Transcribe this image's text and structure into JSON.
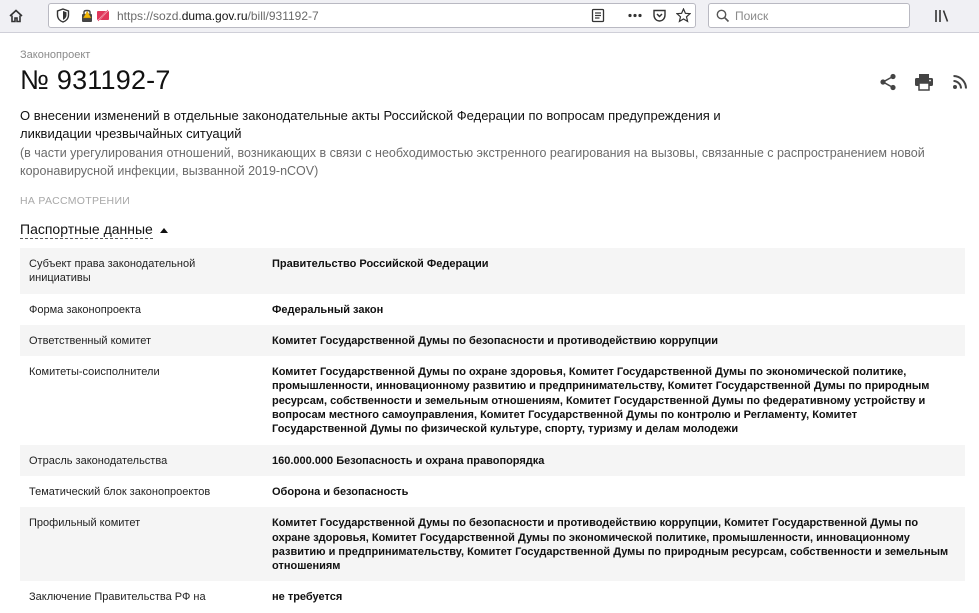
{
  "browser": {
    "url_prefix": "https://sozd.",
    "url_domain": "duma.gov.ru",
    "url_path": "/bill/931192-7",
    "search_placeholder": "Поиск"
  },
  "bill": {
    "kicker": "Законопроект",
    "number": "№ 931192-7",
    "title": "О внесении изменений в отдельные законодательные акты Российской Федерации по вопросам предупреждения и ликвидации чрезвычайных ситуаций",
    "subtitle": "(в части урегулирования отношений, возникающих в связи с необходимостью экстренного реагирования на вызовы, связанные с распространением новой коронавирусной инфекции, вызванной 2019-nCOV)",
    "status": "НА РАССМОТРЕНИИ"
  },
  "passport": {
    "label": "Паспортные данные",
    "rows": [
      {
        "label": "Субъект права законодательной инициативы",
        "value": "Правительство Российской Федерации"
      },
      {
        "label": "Форма законопроекта",
        "value": "Федеральный закон"
      },
      {
        "label": "Ответственный комитет",
        "value": "Комитет Государственной Думы по безопасности и противодействию коррупции"
      },
      {
        "label": "Комитеты-соисполнители",
        "value": "Комитет Государственной Думы по охране здоровья, Комитет Государственной Думы по экономической политике, промышленности, инновационному развитию и предпринимательству, Комитет Государственной Думы по природным ресурсам, собственности и земельным отношениям, Комитет Государственной Думы по федеративному устройству и вопросам местного самоуправления, Комитет Государственной Думы по контролю и Регламенту, Комитет Государственной Думы по физической культуре, спорту, туризму и делам молодежи"
      },
      {
        "label": "Отрасль законодательства",
        "value": "160.000.000 Безопасность и охрана правопорядка"
      },
      {
        "label": "Тематический блок законопроектов",
        "value": "Оборона и безопасность"
      },
      {
        "label": "Профильный комитет",
        "value": "Комитет Государственной Думы по безопасности и противодействию коррупции, Комитет Государственной Думы по охране здоровья, Комитет Государственной Думы по экономической политике, промышленности, инновационному развитию и предпринимательству, Комитет Государственной Думы по природным ресурсам, собственности и земельным отношениям"
      },
      {
        "label": "Заключение Правительства РФ на",
        "value": "не требуется"
      }
    ]
  },
  "icons": {
    "share": "share-icon",
    "print": "print-icon",
    "rss": "rss-icon"
  },
  "colors": {
    "toolbar_bg": "#f0f0f4",
    "row_stripe": "#f5f5f5",
    "muted_text": "#6b6b6b",
    "status_text": "#a8a8a8"
  }
}
